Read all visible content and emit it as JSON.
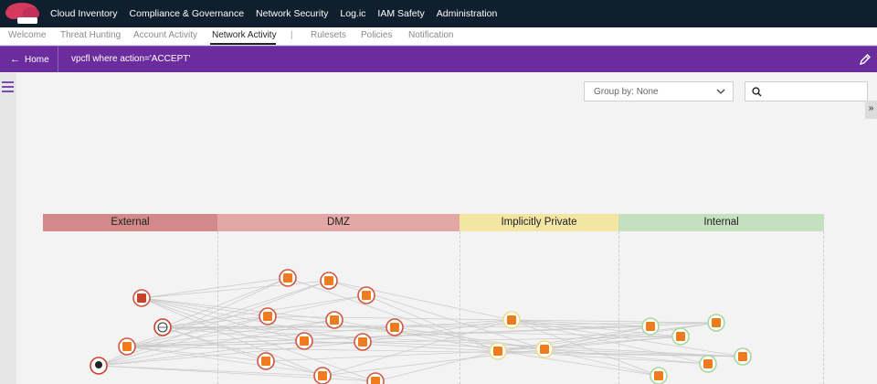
{
  "brand": {
    "logo_top": "CloudGuard",
    "logo_bottom": "Dome9"
  },
  "topnav": {
    "items": [
      "Cloud Inventory",
      "Compliance & Governance",
      "Network Security",
      "Log.ic",
      "IAM Safety",
      "Administration"
    ]
  },
  "subnav": {
    "items": [
      "Welcome",
      "Threat Hunting",
      "Account Activity",
      "Network Activity",
      "|",
      "Rulesets",
      "Policies",
      "Notification"
    ],
    "active": "Network Activity"
  },
  "querybar": {
    "home_label": "Home",
    "query": "vpcfl where action='ACCEPT'"
  },
  "controls": {
    "group_by_label": "Group by: None",
    "search_placeholder": "",
    "collapse_label": "»"
  },
  "zones": [
    "External",
    "DMZ",
    "Implicitly Private",
    "Internal"
  ],
  "colors": {
    "topnav": "#0f1f2e",
    "querybar": "#6b2d9e",
    "external": "#d3898a",
    "dmz": "#e3a8a6",
    "private": "#f3e6a3",
    "internal": "#c4e0bf",
    "node_orange": "#ee7c1f",
    "node_red": "#c9412b"
  },
  "icons": [
    "cloudguard-logo",
    "arrow-left-icon",
    "pencil-icon",
    "hamburger-icon",
    "chevron-down-icon",
    "search-icon",
    "double-chevron-right-icon"
  ]
}
